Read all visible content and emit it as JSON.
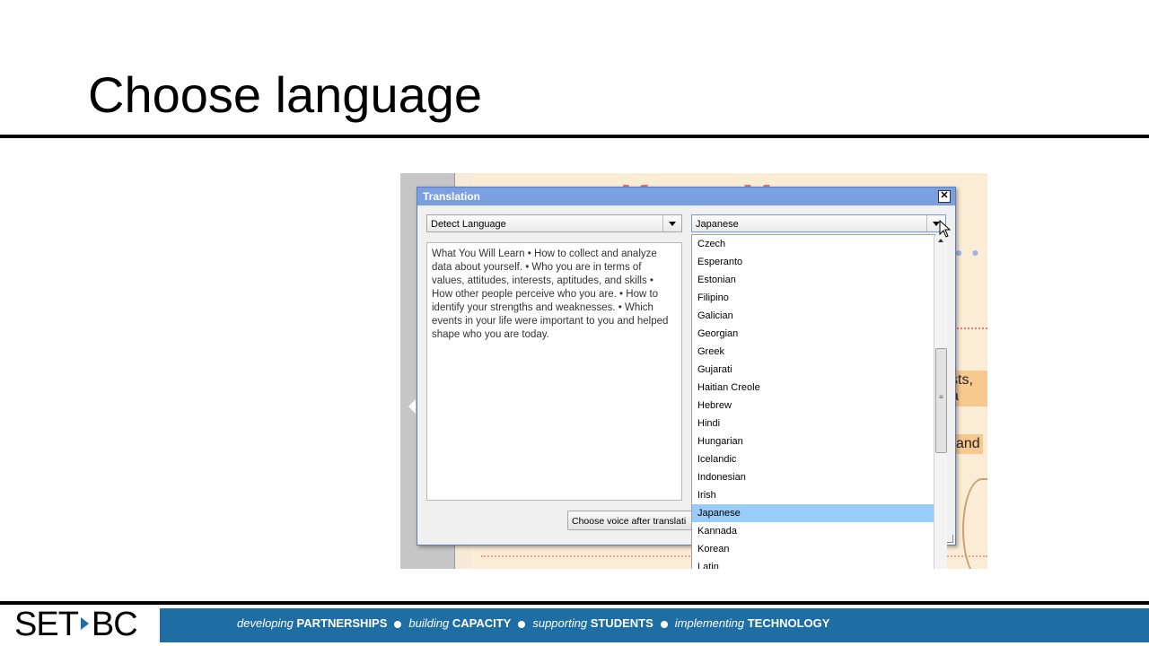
{
  "slide": {
    "title": "Choose language"
  },
  "background_page": {
    "heading_fragment": "Know Yourse",
    "chip_1": "sts, a",
    "chip_2": "and"
  },
  "dialog": {
    "title": "Translation",
    "close_glyph": "✕",
    "source_language": "Detect Language",
    "target_language": "Japanese",
    "source_text": "What You Will Learn • How to collect and analyze data about yourself. • Who you are in terms of values, attitudes, interests, aptitudes, and skills • How other people perceive who you are. • How to identify your strengths and weaknesses. • Which events in your life were important to you and helped shape who you are today.",
    "voice_button_label": "Choose voice after translati"
  },
  "dropdown": {
    "options": [
      "Czech",
      "Esperanto",
      "Estonian",
      "Filipino",
      "Galician",
      "Georgian",
      "Greek",
      "Gujarati",
      "Haitian Creole",
      "Hebrew",
      "Hindi",
      "Hungarian",
      "Icelandic",
      "Indonesian",
      "Irish",
      "Japanese",
      "Kannada",
      "Korean",
      "Latin"
    ],
    "selected": "Japanese",
    "scroll_fraction": 0.45
  },
  "footer": {
    "logo_left": "SET",
    "logo_right": "BC",
    "tagline": [
      {
        "italic": "developing",
        "bold": "PARTNERSHIPS"
      },
      {
        "italic": "building",
        "bold": "CAPACITY"
      },
      {
        "italic": "supporting",
        "bold": "STUDENTS"
      },
      {
        "italic": "implementing",
        "bold": "TECHNOLOGY"
      }
    ]
  },
  "colors": {
    "accent": "#1e6ea4",
    "dialog_titlebar": "#7aa0e2",
    "selected_item": "#99ccf6"
  },
  "icons": [
    "close-icon",
    "dropdown-arrow-icon",
    "scroll-up-icon",
    "mouse-pointer-icon",
    "logo-arrow-icon"
  ]
}
